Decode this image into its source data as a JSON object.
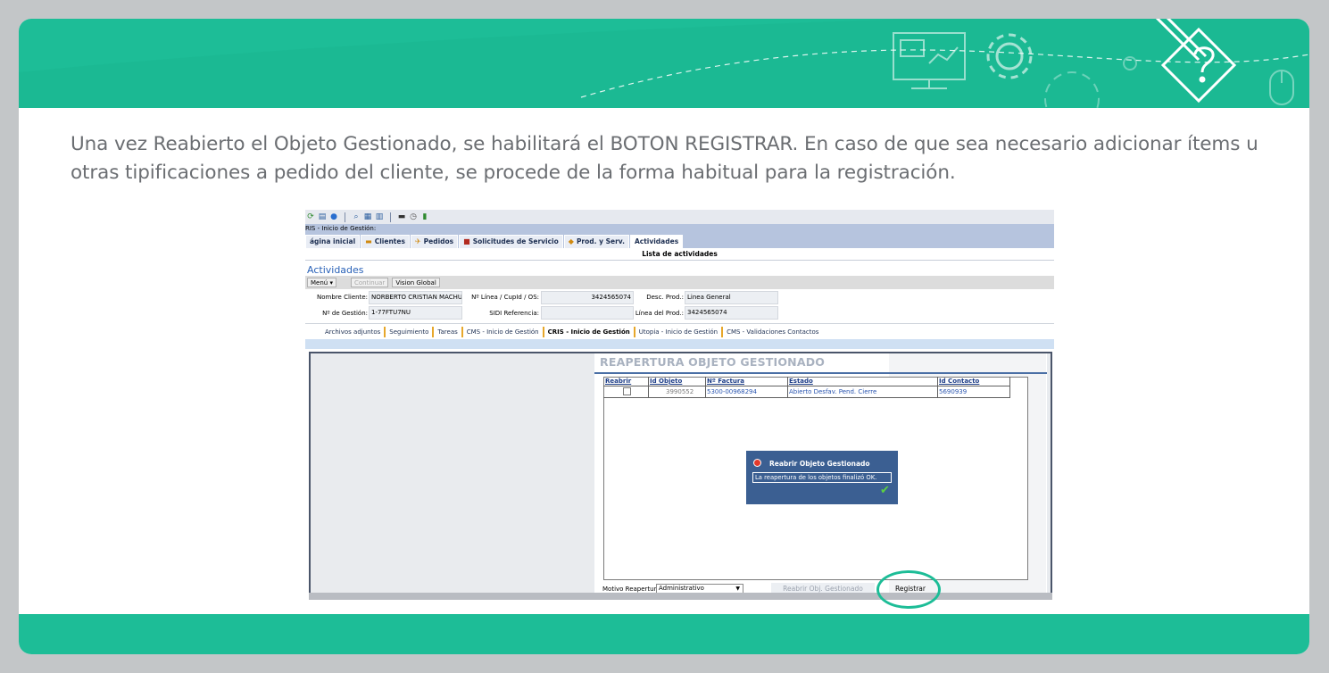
{
  "intro_text": "Una vez Reabierto el Objeto Gestionado, se habilitará el BOTON REGISTRAR. En caso de que sea necesario adicionar ítems u otras tipificaciones a pedido del cliente, se procede de la forma habitual para la registración.",
  "colors": {
    "brand": "#1dbd97",
    "background": "#c3c6c8",
    "text": "#6b6e72"
  },
  "banner_icons": [
    "monitor-icon",
    "gear-icon",
    "pencil-question-icon",
    "mouse-icon"
  ],
  "app": {
    "window_title": "RIS - Inicio de Gestión:",
    "nav_tabs": [
      {
        "label": "ágina inicial",
        "icon": ""
      },
      {
        "label": "Clientes",
        "icon": "folder-icon"
      },
      {
        "label": "Pedidos",
        "icon": "cart-icon"
      },
      {
        "label": "Solicitudes de Servicio",
        "icon": "toolbox-icon"
      },
      {
        "label": "Prod. y Serv.",
        "icon": "box-icon"
      },
      {
        "label": "Actividades",
        "icon": ""
      }
    ],
    "list_header": "Lista de actividades",
    "section_title": "Actividades",
    "menu": {
      "menu_label": "Menú ▾",
      "continuar_label": "Continuar",
      "vision_label": "Vision Global"
    },
    "form": {
      "nombre_cliente_label": "Nombre Cliente:",
      "nombre_cliente_value": "NORBERTO CRISTIAN MACHUNS",
      "nro_gestion_label": "Nº de Gestión:",
      "nro_gestion_value": "1-77FTU7NU",
      "nro_linea_label": "Nº Línea / CupId / OS:",
      "nro_linea_value": "3424565074",
      "sidi_label": "SIDI Referencia:",
      "sidi_value": "",
      "desc_prod_label": "Desc. Prod.:",
      "desc_prod_value": "Linea General",
      "linea_prod_label": "Línea del Prod.:",
      "linea_prod_value": "3424565074"
    },
    "sub_tabs": [
      "Archivos adjuntos",
      "Seguimiento",
      "Tareas",
      "CMS - Inicio de Gestión",
      "CRIS - Inicio de Gestión",
      "Utopia - Inicio de Gestión",
      "CMS - Validaciones Contactos"
    ],
    "reapertura": {
      "title": "REAPERTURA OBJETO GESTIONADO",
      "columns": [
        "Reabrir",
        "Id Objeto",
        "Nº Factura",
        "Estado",
        "Id Contacto"
      ],
      "rows": [
        {
          "reabrir": false,
          "id_objeto": "3990552",
          "factura": "5300-00968294",
          "estado": "Abierto Desfav. Pend. Cierre",
          "id_contacto": "5690939"
        }
      ],
      "motivo_label": "Motivo Reapertura",
      "motivo_value": "Administrativo",
      "reabrir_button": "Reabrir Obj. Gestionado",
      "registrar_button": "Registrar"
    },
    "dialog": {
      "title": "Reabrir Objeto Gestionado",
      "message": "La reapertura de los objetos finalizó OK."
    }
  }
}
